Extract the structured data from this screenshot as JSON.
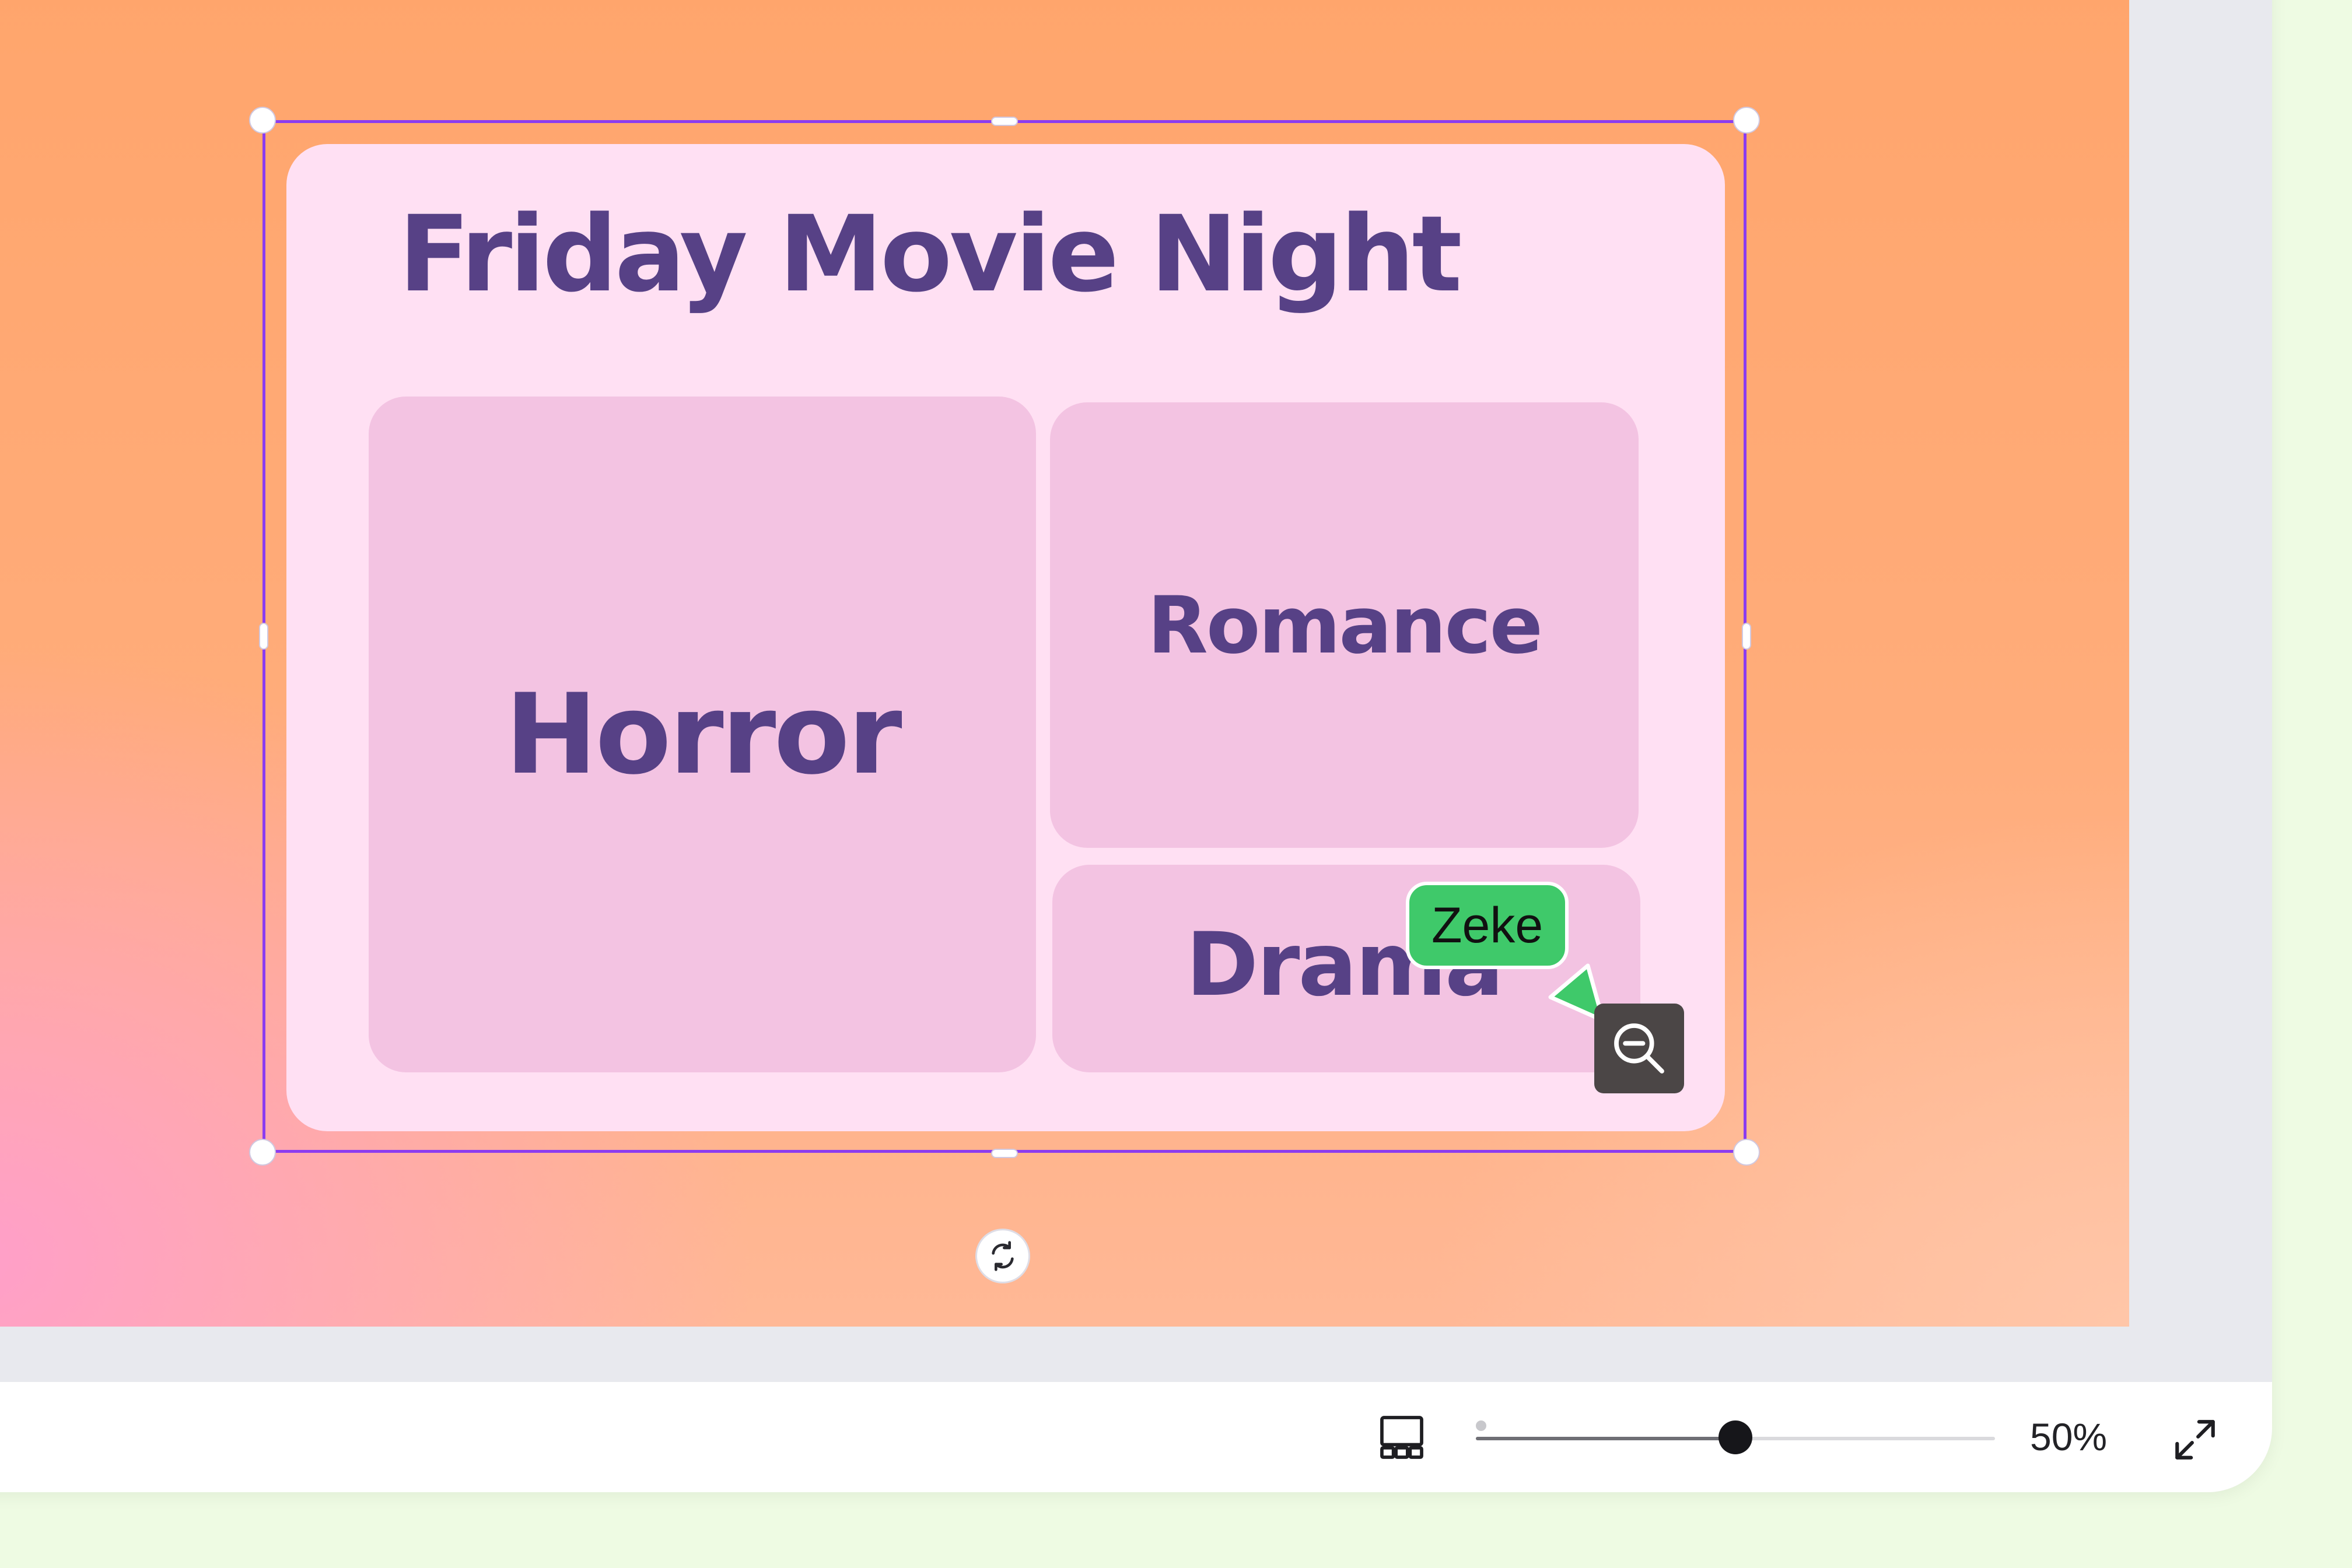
{
  "slide": {
    "title": "Friday Movie Night",
    "tiles": [
      {
        "label": "Horror"
      },
      {
        "label": "Romance"
      },
      {
        "label": "Drama"
      }
    ]
  },
  "collaborator_cursor": {
    "name": "Zeke",
    "color": "#3fc96a"
  },
  "tooltip": {
    "icon": "zoom-out-icon"
  },
  "bottom_bar": {
    "layout_icon": "grid-view-icon",
    "zoom": {
      "value_label": "50%",
      "level": 0.5
    },
    "fullscreen_icon": "fullscreen-icon"
  },
  "colors": {
    "selection": "#8b3cf0",
    "title_text": "#574186",
    "card": "#ffe0f3",
    "tile": "#f3c3e2"
  }
}
